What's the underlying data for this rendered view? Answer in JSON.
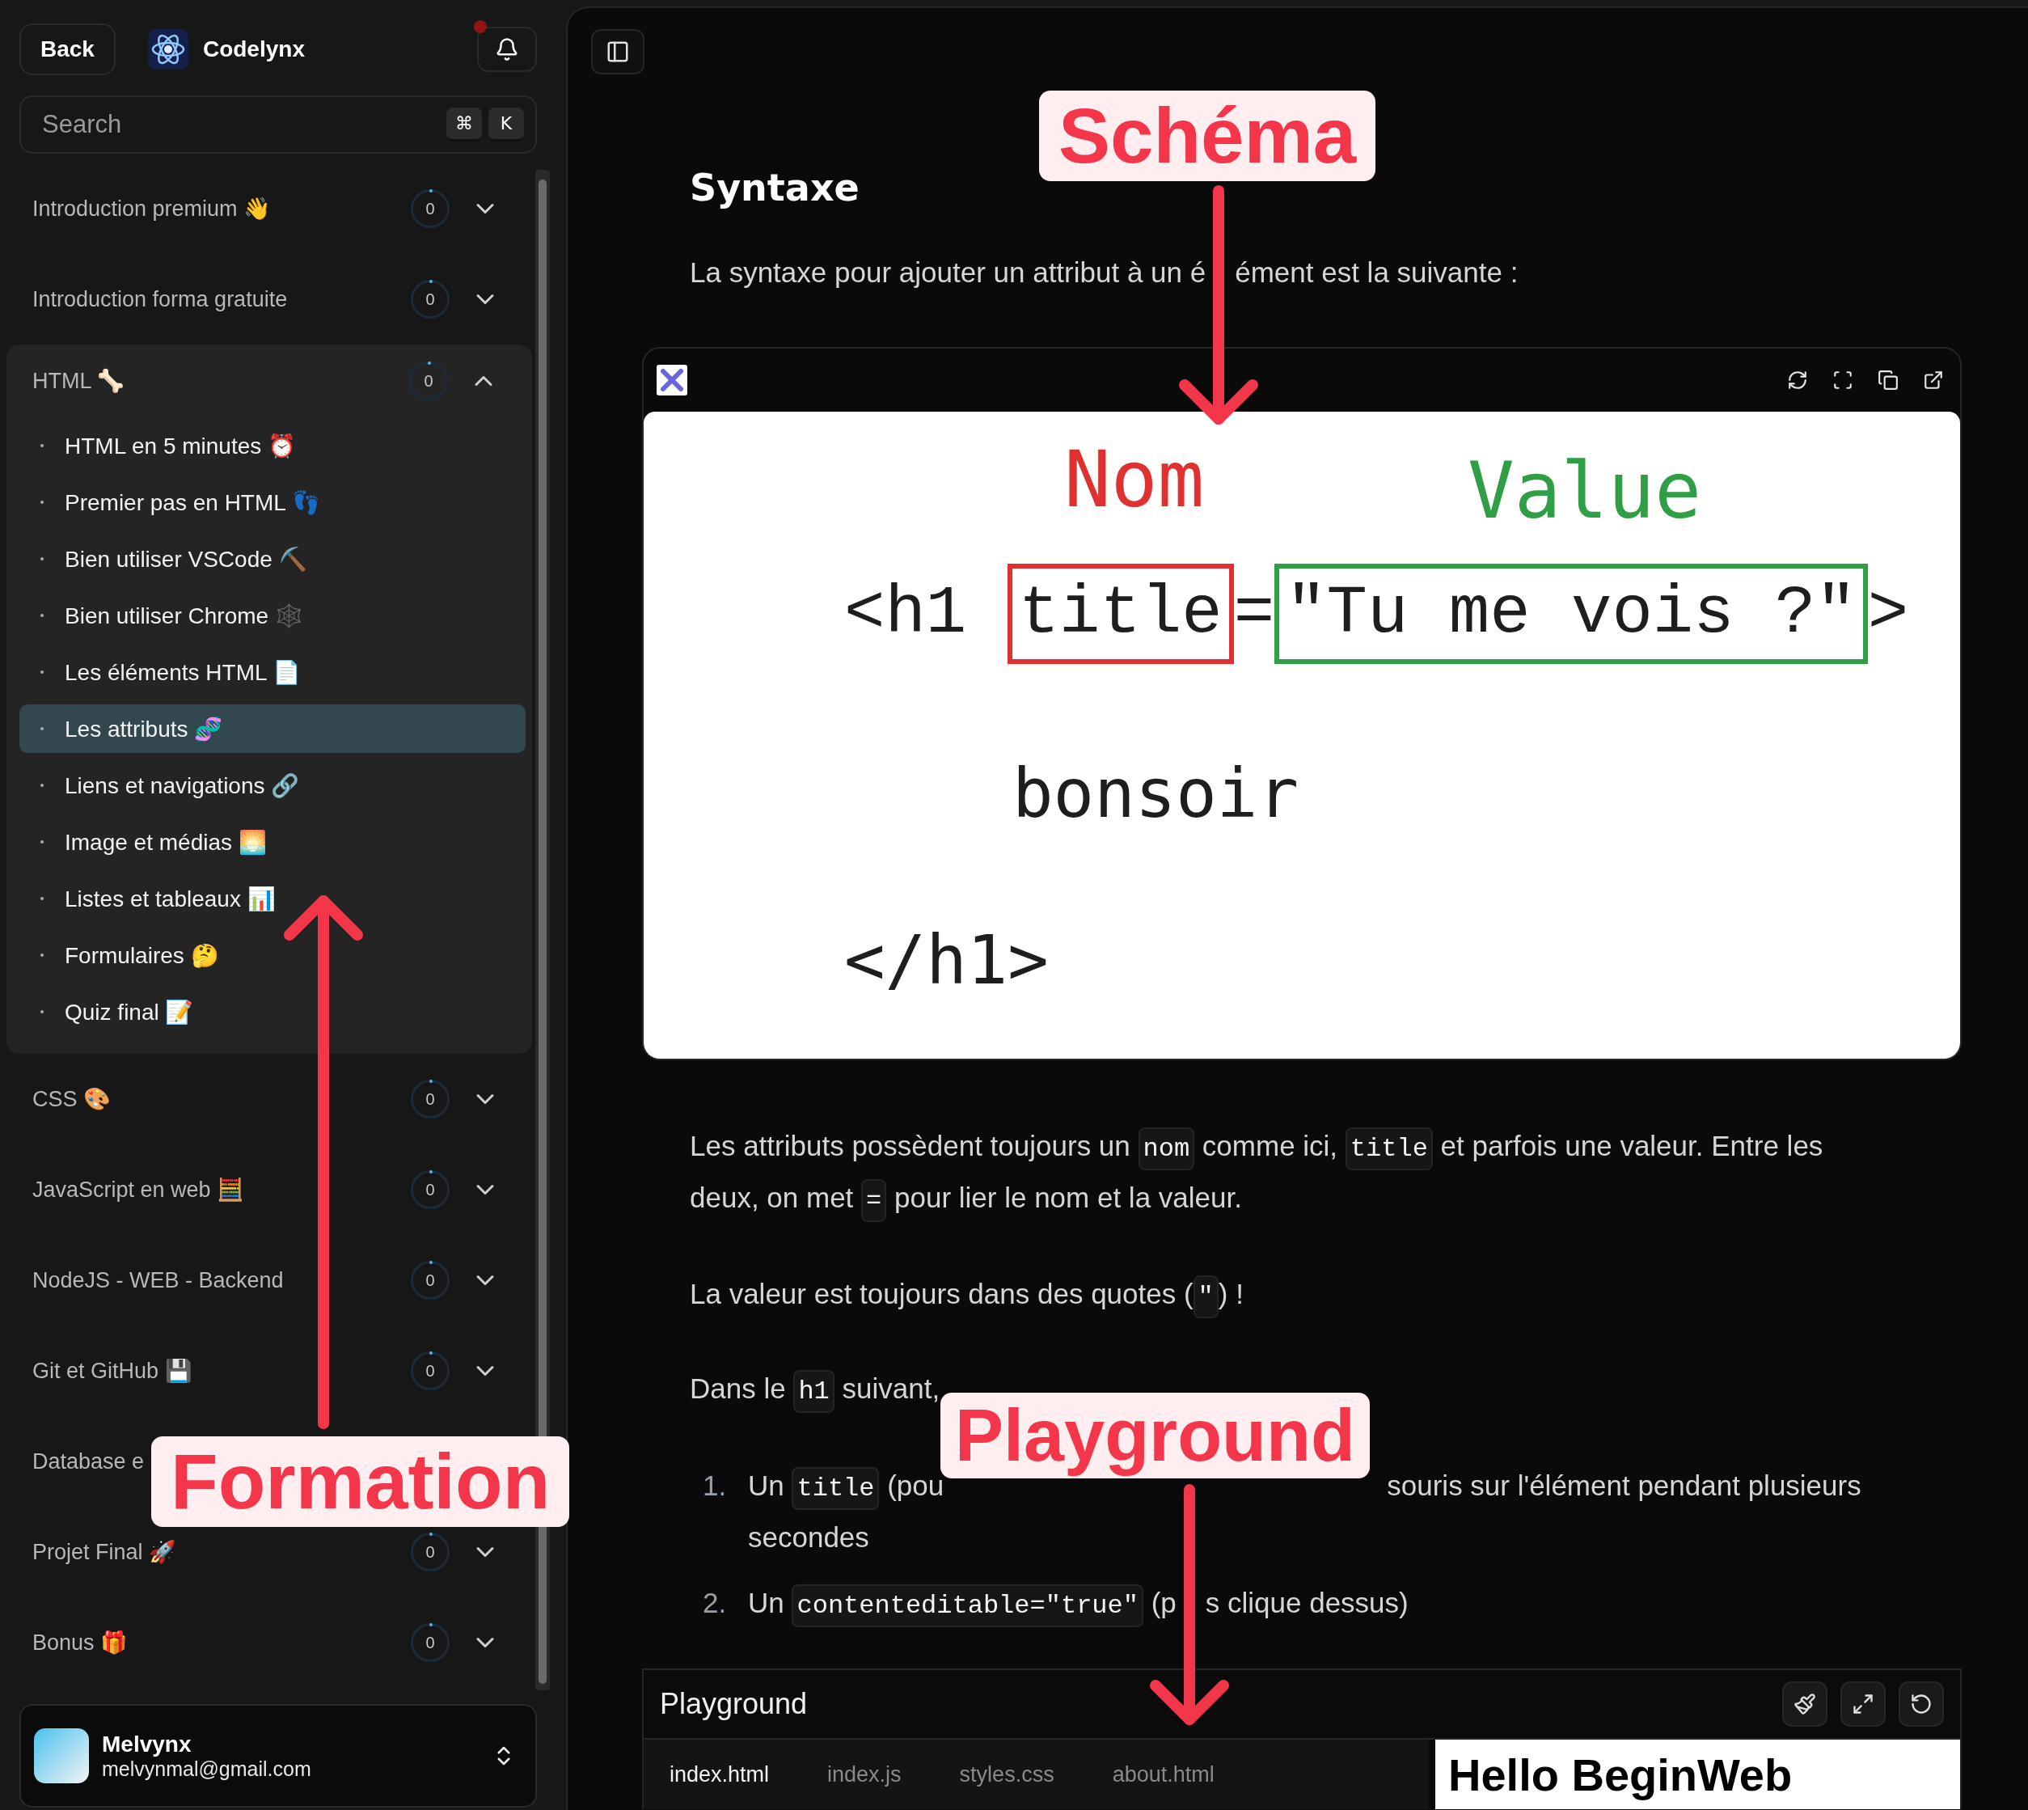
{
  "sidebar": {
    "back_button": "Back",
    "brand": "Codelynx",
    "notification_unread": true,
    "search": {
      "placeholder": "Search",
      "shortcut": [
        "⌘",
        "K"
      ]
    },
    "sections": [
      {
        "title": "Introduction premium 👋",
        "progress": "0",
        "expanded": false
      },
      {
        "title": "Introduction forma gratuite",
        "progress": "0",
        "expanded": false
      },
      {
        "title": "HTML 🦴",
        "progress": "0",
        "expanded": true,
        "children": [
          {
            "title": "HTML en 5 minutes ⏰",
            "selected": false
          },
          {
            "title": "Premier pas en HTML 👣",
            "selected": false
          },
          {
            "title": "Bien utiliser VSCode ⛏️",
            "selected": false
          },
          {
            "title": "Bien utiliser Chrome 🕸️",
            "selected": false
          },
          {
            "title": "Les éléments HTML 📄",
            "selected": false
          },
          {
            "title": "Les attributs 🧬",
            "selected": true
          },
          {
            "title": "Liens et navigations 🔗",
            "selected": false
          },
          {
            "title": "Image et médias 🌅",
            "selected": false
          },
          {
            "title": "Listes et tableaux 📊",
            "selected": false
          },
          {
            "title": "Formulaires 🤔",
            "selected": false
          },
          {
            "title": "Quiz final 📝",
            "selected": false
          }
        ]
      },
      {
        "title": "CSS 🎨",
        "progress": "0",
        "expanded": false
      },
      {
        "title": "JavaScript en web 🧮",
        "progress": "0",
        "expanded": false
      },
      {
        "title": "NodeJS - WEB - Backend",
        "progress": "0",
        "expanded": false
      },
      {
        "title": "Git et GitHub 💾",
        "progress": "0",
        "expanded": false
      },
      {
        "title": "Database e",
        "expanded": false
      },
      {
        "title": "Projet Final 🚀",
        "progress": "0",
        "expanded": false
      },
      {
        "title": "Bonus 🎁",
        "progress": "0",
        "expanded": false
      }
    ],
    "user": {
      "name": "Melvynx",
      "email": "melvynmal@gmail.com"
    }
  },
  "main": {
    "heading": "Syntaxe",
    "intro": [
      {
        "kind": "text",
        "text": "La syntaxe pour ajouter un attribut à un é"
      },
      {
        "kind": "gap"
      },
      {
        "kind": "text",
        "text": "ément est la suivante :"
      }
    ],
    "diagram": {
      "name_label": "Nom",
      "value_label": "Value",
      "open_tag": "<h1",
      "attribute": "title",
      "equals": "=",
      "value": "\"Tu me vois ?\"",
      "close_bracket": ">",
      "content": "bonsoir",
      "close_tag": "</h1>"
    },
    "paragraphs": [
      {
        "segments": [
          {
            "kind": "text",
            "text": "Les attributs possèdent toujours un "
          },
          {
            "kind": "code",
            "text": "nom"
          },
          {
            "kind": "text",
            "text": " comme ici, "
          },
          {
            "kind": "code",
            "text": "title"
          },
          {
            "kind": "text",
            "text": " et parfois une valeur. Entre les deux, on met "
          },
          {
            "kind": "code",
            "text": "="
          },
          {
            "kind": "text",
            "text": " pour lier le nom et la valeur."
          }
        ]
      },
      {
        "segments": [
          {
            "kind": "text",
            "text": "La valeur est toujours dans des quotes ("
          },
          {
            "kind": "code",
            "text": "\""
          },
          {
            "kind": "text",
            "text": ") !"
          }
        ]
      },
      {
        "segments": [
          {
            "kind": "text",
            "text": "Dans le "
          },
          {
            "kind": "code",
            "text": "h1"
          },
          {
            "kind": "text",
            "text": " suivant,"
          }
        ]
      }
    ],
    "steps": [
      {
        "number": "1.",
        "segments": [
          {
            "kind": "text",
            "text": "Un "
          },
          {
            "kind": "code",
            "text": "title"
          },
          {
            "kind": "text",
            "text": " (pou"
          },
          {
            "kind": "wide_gap"
          },
          {
            "kind": "text",
            "text": "souris sur l'élément pendant plusieurs secondes"
          }
        ]
      },
      {
        "number": "2.",
        "segments": [
          {
            "kind": "text",
            "text": "Un "
          },
          {
            "kind": "code",
            "text": "contenteditable=\"true\""
          },
          {
            "kind": "text",
            "text": " (p"
          },
          {
            "kind": "gap"
          },
          {
            "kind": "text",
            "text": "s clique dessus)"
          }
        ]
      }
    ],
    "playground": {
      "title": "Playground",
      "tabs": [
        {
          "label": "index.html",
          "selected": true
        },
        {
          "label": "index.js",
          "selected": false
        },
        {
          "label": "styles.css",
          "selected": false
        },
        {
          "label": "about.html",
          "selected": false
        }
      ],
      "preview_heading": "Hello BeginWeb"
    }
  },
  "annotations": [
    {
      "label": "Schéma",
      "kind": "down"
    },
    {
      "label": "Formation",
      "kind": "up"
    },
    {
      "label": "Playground",
      "kind": "down"
    }
  ]
}
